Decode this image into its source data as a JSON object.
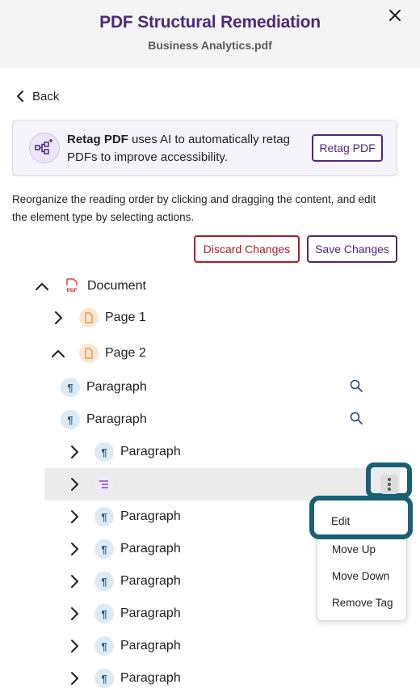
{
  "header": {
    "title": "PDF Structural Remediation",
    "filename": "Business Analytics.pdf"
  },
  "nav": {
    "back_label": "Back"
  },
  "banner": {
    "bold_text": "Retag PDF",
    "text": " uses AI to automatically retag PDFs to improve accessibility.",
    "button_label": "Retag PDF"
  },
  "instructions": "Reorganize the reading order by clicking and dragging the content, and edit the element type by selecting actions.",
  "actions": {
    "discard_label": "Discard Changes",
    "save_label": "Save Changes"
  },
  "tree": {
    "document": "Document",
    "page1": "Page 1",
    "page2": "Page 2",
    "para_a": "Paragraph",
    "para_b": "Paragraph",
    "child_1": "Paragraph",
    "child_3": "Paragraph",
    "child_4": "Paragraph",
    "child_5": "Paragraph",
    "child_6": "Paragraph",
    "child_7": "Paragraph",
    "child_8": "Paragraph"
  },
  "context_menu": {
    "edit": "Edit",
    "move_up": "Move Up",
    "move_down": "Move Down",
    "remove_tag": "Remove Tag"
  },
  "icons": {
    "pdf_badge": "PDF",
    "paragraph_glyph": "¶"
  },
  "colors": {
    "brand_purple": "#4b2a7a",
    "danger_red": "#b01c28",
    "focus_teal": "#1b5f73"
  }
}
